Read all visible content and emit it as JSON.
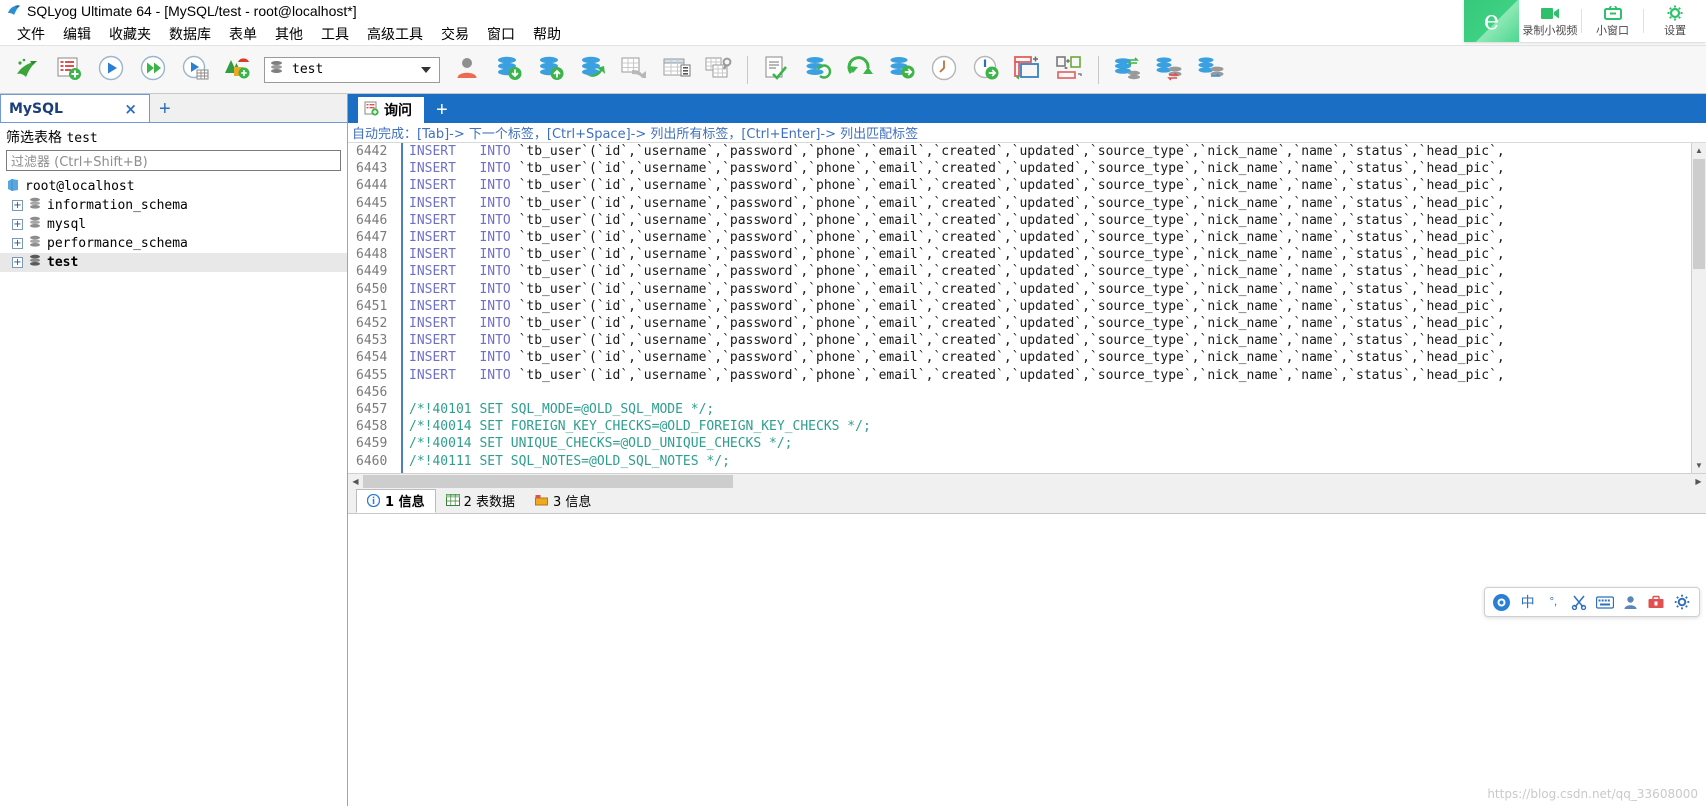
{
  "window": {
    "title": "SQLyog Ultimate 64 - [MySQL/test - root@localhost*]",
    "app_icon": "sqlyog-dolphin-icon"
  },
  "menubar": {
    "items": [
      {
        "label": "文件",
        "name": "menu-file"
      },
      {
        "label": "编辑",
        "name": "menu-edit"
      },
      {
        "label": "收藏夹",
        "name": "menu-favorites"
      },
      {
        "label": "数据库",
        "name": "menu-database"
      },
      {
        "label": "表单",
        "name": "menu-table"
      },
      {
        "label": "其他",
        "name": "menu-others"
      },
      {
        "label": "工具",
        "name": "menu-tools"
      },
      {
        "label": "高级工具",
        "name": "menu-powertools"
      },
      {
        "label": "交易",
        "name": "menu-transaction"
      },
      {
        "label": "窗口",
        "name": "menu-window"
      },
      {
        "label": "帮助",
        "name": "menu-help"
      }
    ]
  },
  "toolbar": {
    "db_selector_value": "test",
    "buttons": [
      {
        "name": "new-connection-icon"
      },
      {
        "name": "new-query-tab-icon"
      },
      {
        "name": "execute-query-icon"
      },
      {
        "name": "execute-all-queries-icon"
      },
      {
        "name": "execute-query-and-edit-icon"
      },
      {
        "name": "stop-query-icon"
      },
      {
        "name": "user-manager-icon"
      },
      {
        "name": "import-database-icon"
      },
      {
        "name": "export-database-icon"
      },
      {
        "name": "sync-database-icon"
      },
      {
        "name": "import-external-data-icon"
      },
      {
        "name": "table-data-icon"
      },
      {
        "name": "schema-designer-icon"
      },
      {
        "name": "sql-formatter-icon"
      },
      {
        "name": "database-refresh-icon"
      },
      {
        "name": "refresh-icon"
      },
      {
        "name": "database-next-icon"
      },
      {
        "name": "query-history-icon"
      },
      {
        "name": "scheduled-job-icon"
      },
      {
        "name": "object-browser-layout-icon"
      },
      {
        "name": "result-layout-icon"
      },
      {
        "name": "data-sync-icon"
      },
      {
        "name": "structure-sync-icon"
      },
      {
        "name": "schema-sync-icon"
      }
    ]
  },
  "recorder_overlay": {
    "logo_glyph": "e",
    "items": [
      {
        "label": "录制小视频",
        "icon": "video-camera-icon"
      },
      {
        "label": "小窗口",
        "icon": "mini-window-icon"
      },
      {
        "label": "设置",
        "icon": "gear-icon"
      }
    ]
  },
  "sidebar": {
    "connection_tab": {
      "label": "MySQL",
      "close": "×",
      "add": "+"
    },
    "filter_title_prefix": "筛选表格",
    "filter_title_name": "test",
    "filter_placeholder": "过滤器 (Ctrl+Shift+B)",
    "tree": [
      {
        "label": "root@localhost",
        "level": 0,
        "icon": "server-icon",
        "expander": "",
        "selected": false,
        "bold": false
      },
      {
        "label": "information_schema",
        "level": 1,
        "icon": "database-icon",
        "expander": "+",
        "selected": false,
        "bold": false
      },
      {
        "label": "mysql",
        "level": 1,
        "icon": "database-icon",
        "expander": "+",
        "selected": false,
        "bold": false
      },
      {
        "label": "performance_schema",
        "level": 1,
        "icon": "database-icon",
        "expander": "+",
        "selected": false,
        "bold": false
      },
      {
        "label": "test",
        "level": 1,
        "icon": "database-icon",
        "expander": "+",
        "selected": true,
        "bold": true
      }
    ]
  },
  "query_panel": {
    "tab_label": "询问",
    "tab_icon": "query-tab-icon",
    "add_tab": "+",
    "hint": "自动完成：[Tab]-> 下一个标签，[Ctrl+Space]-> 列出所有标签，[Ctrl+Enter]-> 列出匹配标签",
    "first_line_number": 6442,
    "insert_line": "INSERT   INTO `tb_user`(`id`,`username`,`password`,`phone`,`email`,`created`,`updated`,`source_type`,`nick_name`,`name`,`status`,`head_pic`,",
    "lines": [
      {
        "n": 6442,
        "type": "insert"
      },
      {
        "n": 6443,
        "type": "insert"
      },
      {
        "n": 6444,
        "type": "insert"
      },
      {
        "n": 6445,
        "type": "insert"
      },
      {
        "n": 6446,
        "type": "insert"
      },
      {
        "n": 6447,
        "type": "insert"
      },
      {
        "n": 6448,
        "type": "insert"
      },
      {
        "n": 6449,
        "type": "insert"
      },
      {
        "n": 6450,
        "type": "insert"
      },
      {
        "n": 6451,
        "type": "insert"
      },
      {
        "n": 6452,
        "type": "insert"
      },
      {
        "n": 6453,
        "type": "insert"
      },
      {
        "n": 6454,
        "type": "insert"
      },
      {
        "n": 6455,
        "type": "insert"
      },
      {
        "n": 6456,
        "type": "blank",
        "text": ""
      },
      {
        "n": 6457,
        "type": "comment",
        "text": "/*!40101 SET SQL_MODE=@OLD_SQL_MODE */;"
      },
      {
        "n": 6458,
        "type": "comment",
        "text": "/*!40014 SET FOREIGN_KEY_CHECKS=@OLD_FOREIGN_KEY_CHECKS */;"
      },
      {
        "n": 6459,
        "type": "comment",
        "text": "/*!40014 SET UNIQUE_CHECKS=@OLD_UNIQUE_CHECKS */;"
      },
      {
        "n": 6460,
        "type": "comment",
        "text": "/*!40111 SET SQL_NOTES=@OLD_SQL_NOTES */;"
      }
    ]
  },
  "result_tabs": [
    {
      "label": "1 信息",
      "icon": "info-icon",
      "active": true
    },
    {
      "label": "2 表数据",
      "icon": "table-data-icon",
      "active": false
    },
    {
      "label": "3 信息",
      "icon": "messages-icon",
      "active": false
    }
  ],
  "ime_bar": {
    "items": [
      {
        "name": "ime-logo-icon",
        "glyph": "◉"
      },
      {
        "name": "ime-chinese-mode",
        "glyph": "中"
      },
      {
        "name": "ime-punctuation-icon",
        "glyph": "°,"
      },
      {
        "name": "ime-scissors-icon",
        "glyph": "✂"
      },
      {
        "name": "ime-keyboard-icon",
        "glyph": "⌨"
      },
      {
        "name": "ime-user-icon",
        "glyph": "👤"
      },
      {
        "name": "ime-toolbox-icon",
        "glyph": "🧰"
      },
      {
        "name": "ime-settings-icon",
        "glyph": "⚙"
      }
    ]
  },
  "watermark": "https://blog.csdn.net/qq_33608000"
}
